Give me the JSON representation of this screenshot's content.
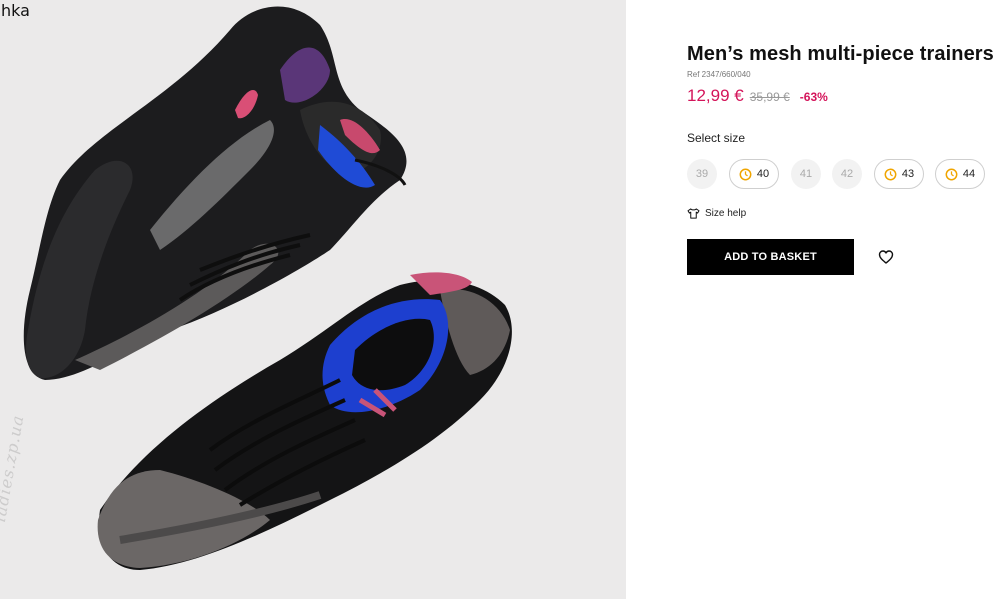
{
  "corner_text": "hka",
  "watermark": "ladies.zp.ua",
  "product": {
    "title": "Men’s mesh multi-piece trainers",
    "ref": "Ref 2347/660/040",
    "price_current": "12,99 €",
    "price_old": "35,99 €",
    "discount": "-63%"
  },
  "size_selector": {
    "label": "Select size",
    "sizes": [
      {
        "label": "39",
        "available": false
      },
      {
        "label": "40",
        "available": true,
        "icon": "clock-icon"
      },
      {
        "label": "41",
        "available": false
      },
      {
        "label": "42",
        "available": false
      },
      {
        "label": "43",
        "available": true,
        "icon": "clock-icon"
      },
      {
        "label": "44",
        "available": true,
        "icon": "clock-icon"
      }
    ]
  },
  "size_help": {
    "label": "Size help",
    "icon": "tshirt-icon"
  },
  "actions": {
    "add_to_basket": "ADD TO BASKET",
    "wishlist_icon": "heart-icon"
  },
  "colors": {
    "price": "#d4145a",
    "button_bg": "#000000",
    "image_bg": "#ebeaea",
    "clock": "#f0a500"
  }
}
